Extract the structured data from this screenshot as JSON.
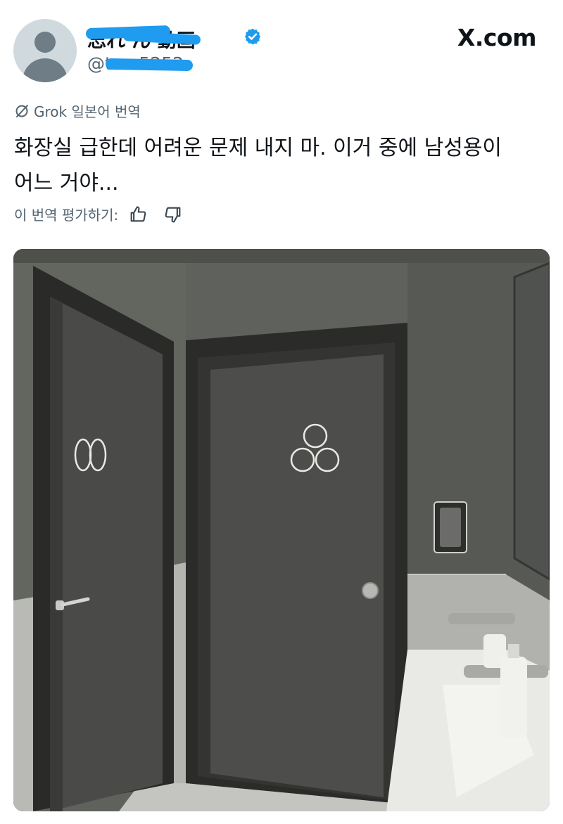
{
  "header": {
    "display_name": "忘れ    ん  動画",
    "handle": "@ta        a5252",
    "brand": "X.com"
  },
  "translation": {
    "label": "Grok 일본어 번역",
    "text_lines": [
      "화장실 급한데 어려운 문제 내지 마. 이거 중에 남성용이",
      "어느 거야..."
    ],
    "rate_label": "이 번역 평가하기:"
  },
  "colors": {
    "verified": "#1d9bf0",
    "redaction": "#1f9bf0",
    "secondary_text": "#536471"
  },
  "icons": {
    "grok": "slashed-circle-icon",
    "verified": "verified-badge-icon",
    "rate_up": "thumbs-up-icon",
    "rate_down": "thumbs-down-icon"
  }
}
